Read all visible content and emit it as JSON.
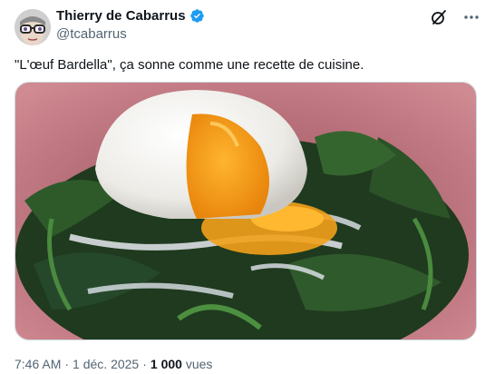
{
  "author": {
    "display_name": "Thierry de Cabarrus",
    "handle": "@tcabarrus",
    "verified": true,
    "avatar_icon": "avatar-glasses-face",
    "badge_color": "#1d9bf0"
  },
  "actions": {
    "grok_icon": "grok-icon",
    "more_icon": "more-icon"
  },
  "tweet": {
    "text": "\"L'œuf Bardella\", ça sonne comme une recette de cuisine."
  },
  "media": {
    "kind": "photo",
    "subject": "soft-boiled egg on spinach"
  },
  "meta": {
    "time": "7:46 AM",
    "separator": "·",
    "date": "1 déc. 2025",
    "views_count": "1 000",
    "views_label": " vues"
  },
  "colors": {
    "text_primary": "#0f1419",
    "text_secondary": "#536471",
    "border": "#cfd9de"
  }
}
